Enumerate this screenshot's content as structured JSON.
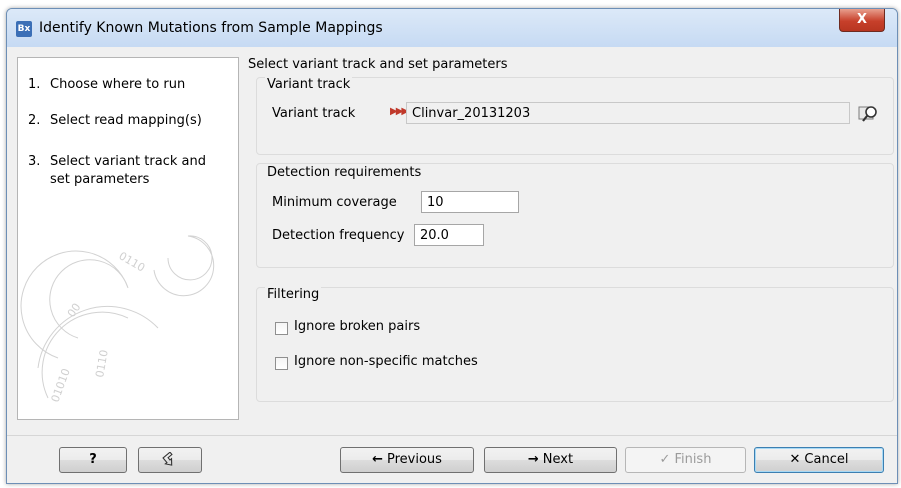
{
  "window": {
    "app_icon": "Bx",
    "title": "Identify Known Mutations from Sample Mappings",
    "close_label": "X"
  },
  "steps": [
    {
      "num": "1.",
      "label": "Choose where to run"
    },
    {
      "num": "2.",
      "label": "Select read mapping(s)"
    },
    {
      "num": "3.",
      "label": "Select variant track and set parameters"
    }
  ],
  "panel": {
    "heading": "Select variant track and set parameters",
    "variant_group": {
      "title": "Variant track",
      "label": "Variant track",
      "value": "Clinvar_20131203",
      "icon": "variant-track-icon",
      "browse_icon": "browse-search-icon"
    },
    "detection_group": {
      "title": "Detection requirements",
      "min_coverage_label": "Minimum coverage",
      "min_coverage_value": "10",
      "freq_label": "Detection frequency",
      "freq_value": "20.0"
    },
    "filter_group": {
      "title": "Filtering",
      "broken_pairs_label": "Ignore broken pairs",
      "broken_pairs_checked": false,
      "nonspecific_label": "Ignore non-specific matches",
      "nonspecific_checked": false
    }
  },
  "footer": {
    "help_label": "?",
    "reset_icon": "reset-icon",
    "previous_label": "Previous",
    "next_label": "Next",
    "finish_label": "Finish",
    "cancel_label": "Cancel"
  }
}
